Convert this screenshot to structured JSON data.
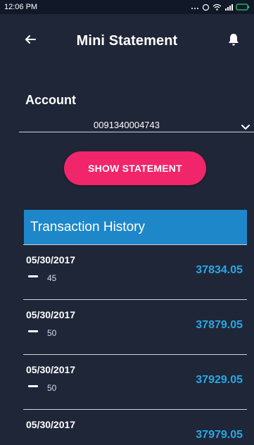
{
  "status_bar": {
    "time": "12:06 PM",
    "icons": [
      "more-dots-icon",
      "alarm-icon",
      "wifi-icon",
      "signal-icon",
      "battery-icon"
    ]
  },
  "header": {
    "title": "Mini Statement",
    "back_icon": "back-arrow-icon",
    "notification_icon": "bell-icon"
  },
  "account": {
    "label": "Account",
    "selected_value": "0091340004743"
  },
  "actions": {
    "show_statement_label": "SHOW STATEMENT"
  },
  "history": {
    "title": "Transaction History",
    "transactions": [
      {
        "date": "05/30/2017",
        "amount": "45",
        "balance": "37834.05"
      },
      {
        "date": "05/30/2017",
        "amount": "50",
        "balance": "37879.05"
      },
      {
        "date": "05/30/2017",
        "amount": "50",
        "balance": "37929.05"
      },
      {
        "date": "05/30/2017",
        "amount": "",
        "balance": "37979.05"
      }
    ]
  },
  "colors": {
    "background": "#1f2638",
    "status_bar": "#111827",
    "primary_action": "#f0256a",
    "section_header": "#1e87c9",
    "balance_text": "#27a8e5",
    "divider": "#cfd4de"
  }
}
